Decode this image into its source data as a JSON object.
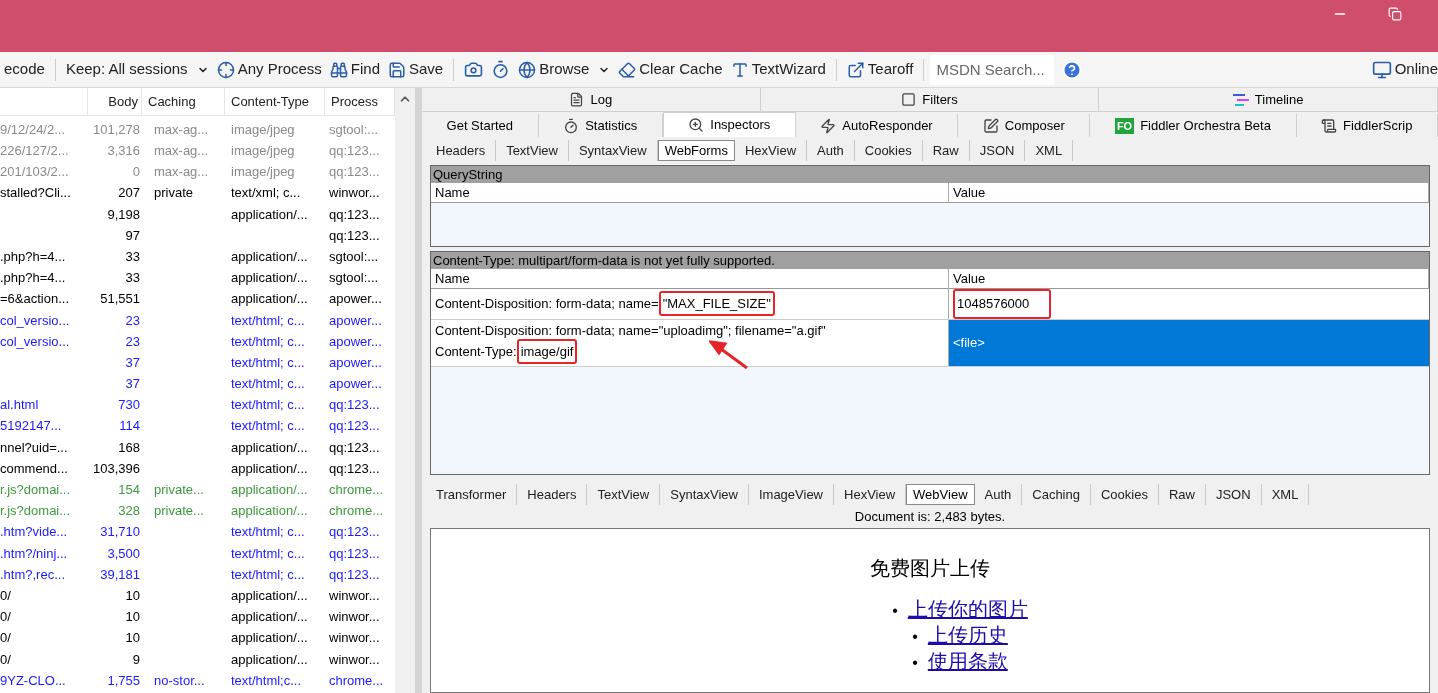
{
  "toolbar": {
    "items": [
      {
        "kind": "button",
        "label": "ecode"
      },
      {
        "kind": "separator"
      },
      {
        "kind": "dropdown",
        "label": "Keep: All sessions"
      },
      {
        "kind": "button",
        "label": "Any Process"
      },
      {
        "kind": "button",
        "label": "Find"
      },
      {
        "kind": "button",
        "label": "Save"
      },
      {
        "kind": "separator"
      },
      {
        "kind": "icon_button"
      },
      {
        "kind": "icon_button"
      },
      {
        "kind": "dropdown",
        "label": "Browse"
      },
      {
        "kind": "button",
        "label": "Clear Cache"
      },
      {
        "kind": "button",
        "label": "TextWizard"
      },
      {
        "kind": "separator"
      },
      {
        "kind": "button",
        "label": "Tearoff"
      },
      {
        "kind": "separator"
      }
    ],
    "search": {
      "placeholder": "MSDN Search..."
    },
    "online": "Online"
  },
  "sessions": {
    "columns": [
      "Body",
      "Caching",
      "Content-Type",
      "Process"
    ],
    "rows": [
      {
        "url": "9/12/24/2...",
        "body": "101,278",
        "caching": "max-ag...",
        "content_type": "image/jpeg",
        "process": "sgtool:...",
        "color": "#8a8a8a"
      },
      {
        "url": "226/127/2...",
        "body": "3,316",
        "caching": "max-ag...",
        "content_type": "image/jpeg",
        "process": "qq:123...",
        "color": "#8a8a8a"
      },
      {
        "url": "201/103/2...",
        "body": "0",
        "caching": "max-ag...",
        "content_type": "image/jpeg",
        "process": "qq:123...",
        "color": "#8a8a8a"
      },
      {
        "url": "stalled?Cli...",
        "body": "207",
        "caching": "private",
        "content_type": "text/xml; c...",
        "process": "winwor...",
        "color": "#000000"
      },
      {
        "body": "9,198",
        "content_type": "application/...",
        "process": "qq:123...",
        "color": "#000000"
      },
      {
        "body": "97",
        "process": "qq:123...",
        "color": "#000000"
      },
      {
        "url": ".php?h=4...",
        "body": "33",
        "content_type": "application/...",
        "process": "sgtool:...",
        "color": "#000000"
      },
      {
        "url": ".php?h=4...",
        "body": "33",
        "content_type": "application/...",
        "process": "sgtool:...",
        "color": "#000000"
      },
      {
        "url": "=6&action...",
        "body": "51,551",
        "content_type": "application/...",
        "process": "apower...",
        "color": "#000000"
      },
      {
        "url": "col_versio...",
        "body": "23",
        "content_type": "text/html; c...",
        "process": "apower...",
        "color": "#1a1aff"
      },
      {
        "url": "col_versio...",
        "body": "23",
        "content_type": "text/html; c...",
        "process": "apower...",
        "color": "#1a1aff"
      },
      {
        "body": "37",
        "content_type": "text/html; c...",
        "process": "apower...",
        "color": "#1a1aff"
      },
      {
        "body": "37",
        "content_type": "text/html; c...",
        "process": "apower...",
        "color": "#1a1aff"
      },
      {
        "url": "al.html",
        "body": "730",
        "content_type": "text/html; c...",
        "process": "qq:123...",
        "color": "#1a1aff"
      },
      {
        "url": "5192147...",
        "body": "114",
        "content_type": "text/html; c...",
        "process": "qq:123...",
        "color": "#1a1aff"
      },
      {
        "url": "nnel?uid=...",
        "body": "168",
        "content_type": "application/...",
        "process": "qq:123...",
        "color": "#000000"
      },
      {
        "url": "commend...",
        "body": "103,396",
        "content_type": "application/...",
        "process": "qq:123...",
        "color": "#000000"
      },
      {
        "url": "r.js?domai...",
        "body": "154",
        "caching": "private...",
        "content_type": "application/...",
        "process": "chrome...",
        "color": "#3d9a3d"
      },
      {
        "url": "r.js?domai...",
        "body": "328",
        "caching": "private...",
        "content_type": "application/...",
        "process": "chrome...",
        "color": "#3d9a3d"
      },
      {
        "url": ".htm?vide...",
        "body": "31,710",
        "content_type": "text/html; c...",
        "process": "qq:123...",
        "color": "#1a1aff"
      },
      {
        "url": ".htm?/ninj...",
        "body": "3,500",
        "content_type": "text/html; c...",
        "process": "qq:123...",
        "color": "#1a1aff"
      },
      {
        "url": ".htm?,rec...",
        "body": "39,181",
        "content_type": "text/html; c...",
        "process": "qq:123...",
        "color": "#1a1aff"
      },
      {
        "url": "0/",
        "body": "10",
        "content_type": "application/...",
        "process": "winwor...",
        "color": "#000000"
      },
      {
        "url": "0/",
        "body": "10",
        "content_type": "application/...",
        "process": "winwor...",
        "color": "#000000"
      },
      {
        "url": "0/",
        "body": "10",
        "content_type": "application/...",
        "process": "winwor...",
        "color": "#000000"
      },
      {
        "url": "0/",
        "body": "9",
        "content_type": "application/...",
        "process": "winwor...",
        "color": "#000000"
      },
      {
        "url": "9YZ-CLO...",
        "body": "1,755",
        "caching": "no-stor...",
        "content_type": "text/html;c...",
        "process": "chrome...",
        "color": "#1a1aff"
      }
    ]
  },
  "top_tabs": [
    {
      "label": "Log"
    },
    {
      "label": "Filters"
    },
    {
      "label": "Timeline"
    }
  ],
  "main_tabs": [
    {
      "label": "Get Started",
      "selected": false
    },
    {
      "label": "Statistics",
      "selected": false
    },
    {
      "label": "Inspectors",
      "selected": true
    },
    {
      "label": "AutoResponder",
      "selected": false
    },
    {
      "label": "Composer",
      "selected": false
    },
    {
      "label": "Fiddler Orchestra Beta",
      "badge": "FO",
      "selected": false
    },
    {
      "label": "FiddlerScrip",
      "selected": false
    }
  ],
  "request_tabs": [
    {
      "label": "Headers",
      "selected": false
    },
    {
      "label": "TextView",
      "selected": false
    },
    {
      "label": "SyntaxView",
      "selected": false
    },
    {
      "label": "WebForms",
      "selected": true
    },
    {
      "label": "HexView",
      "selected": false
    },
    {
      "label": "Auth",
      "selected": false
    },
    {
      "label": "Cookies",
      "selected": false
    },
    {
      "label": "Raw",
      "selected": false
    },
    {
      "label": "JSON",
      "selected": false
    },
    {
      "label": "XML",
      "selected": false
    }
  ],
  "querystring": {
    "title": "QueryString",
    "columns": [
      "Name",
      "Value"
    ]
  },
  "form_data": {
    "notice": "Content-Type: multipart/form-data is not yet fully supported.",
    "columns": [
      "Name",
      "Value"
    ],
    "arrow": true,
    "rows": [
      {
        "name_lines": [
          [
            {
              "text": "Content-Disposition: form-data; name=",
              "highlighted": false
            },
            {
              "text": "\"MAX_FILE_SIZE\"",
              "highlighted": true
            }
          ]
        ],
        "value": "1048576000",
        "value_highlighted": true,
        "selected": false
      },
      {
        "name_lines": [
          [
            {
              "text": "Content-Disposition: form-data; name=\"uploadimg\"; filename=\"a.gif\"",
              "highlighted": false
            }
          ],
          [
            {
              "text": "Content-Type:",
              "highlighted": false
            },
            {
              "text": "image/gif",
              "highlighted": true
            }
          ]
        ],
        "value": "<file>",
        "value_highlighted": false,
        "selected": true
      }
    ]
  },
  "response_tabs": [
    {
      "label": "Transformer",
      "selected": false
    },
    {
      "label": "Headers",
      "selected": false
    },
    {
      "label": "TextView",
      "selected": false
    },
    {
      "label": "SyntaxView",
      "selected": false
    },
    {
      "label": "ImageView",
      "selected": false
    },
    {
      "label": "HexView",
      "selected": false
    },
    {
      "label": "WebView",
      "selected": true
    },
    {
      "label": "Auth",
      "selected": false
    },
    {
      "label": "Caching",
      "selected": false
    },
    {
      "label": "Cookies",
      "selected": false
    },
    {
      "label": "Raw",
      "selected": false
    },
    {
      "label": "JSON",
      "selected": false
    },
    {
      "label": "XML",
      "selected": false
    }
  ],
  "document_status": "Document is: 2,483 bytes.",
  "webview": {
    "heading": "免费图片上传",
    "links": [
      {
        "marker": "•",
        "text": "上传你的图片",
        "children": [
          {
            "marker": "•",
            "text": "上传历史"
          },
          {
            "marker": "•",
            "text": "使用条款"
          }
        ]
      }
    ]
  }
}
